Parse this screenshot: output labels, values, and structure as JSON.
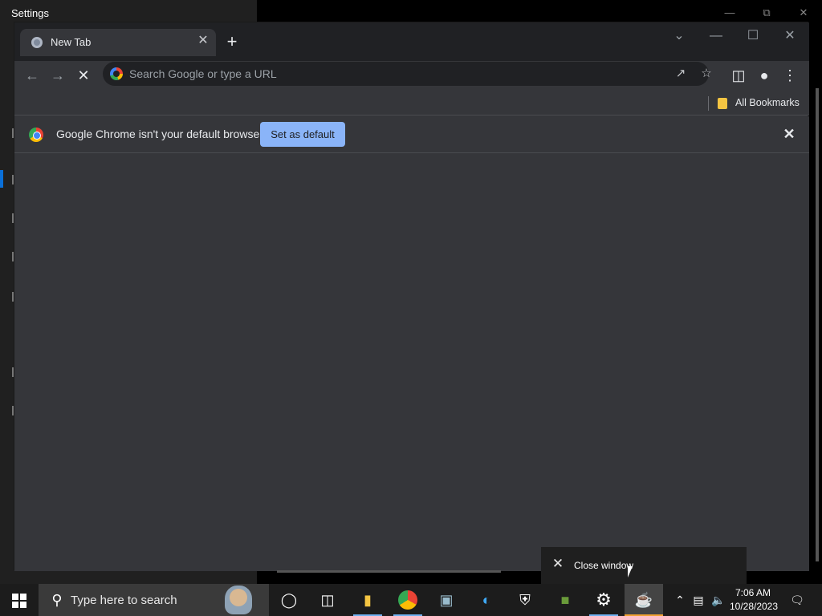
{
  "settings_window": {
    "title": "Settings"
  },
  "chrome": {
    "tab": {
      "title": "New Tab"
    },
    "toolbar": {
      "omnibox_placeholder": "Search Google or type a URL"
    },
    "bookmarks": {
      "all_bookmarks_label": "All Bookmarks"
    },
    "infobar": {
      "message": "Google Chrome isn't your default browser",
      "button_label": "Set as default"
    }
  },
  "taskbar_popup": {
    "label": "Close window"
  },
  "taskbar": {
    "search_placeholder": "Type here to search",
    "clock_time": "7:06 AM",
    "clock_date": "10/28/2023"
  }
}
